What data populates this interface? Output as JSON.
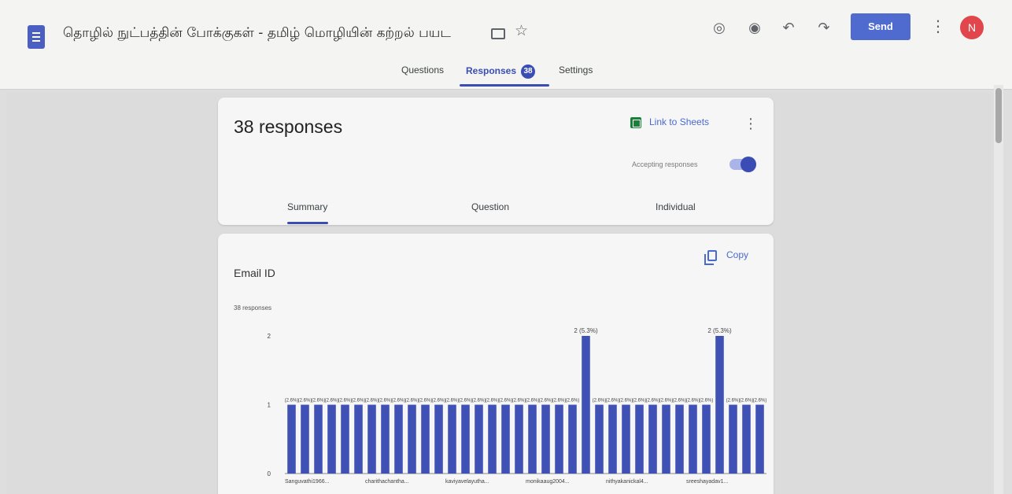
{
  "header": {
    "form_title": "தொழில் நுட்பத்தின் போக்குகள் - தமிழ் மொழியின் கற்றல் பயட",
    "send_label": "Send",
    "avatar_initial": "N",
    "tabs": [
      {
        "label": "Questions"
      },
      {
        "label": "Responses",
        "badge": "38"
      },
      {
        "label": "Settings"
      }
    ]
  },
  "summary_card": {
    "response_count": "38 responses",
    "link_to_sheets": "Link to Sheets",
    "accepting_label": "Accepting responses",
    "sub_tabs": [
      "Summary",
      "Question",
      "Individual"
    ]
  },
  "question_card": {
    "copy_label": "Copy",
    "title": "Email ID",
    "count": "38 responses"
  },
  "colors": {
    "accent": "#3a4db5",
    "send_button": "#4f6bd0",
    "bar": "#3f51b5",
    "avatar": "#e0464b"
  },
  "chart_data": {
    "type": "bar",
    "categories": [
      "Sanguvathi1966...",
      "",
      "",
      "",
      "",
      "",
      "charithachantha...",
      "",
      "",
      "",
      "",
      "",
      "kaviyavelayutha...",
      "",
      "",
      "",
      "",
      "",
      "monikaaug2004...",
      "",
      "",
      "",
      "",
      "",
      "nithyakanickal4...",
      "",
      "",
      "",
      "",
      "",
      "sreeshayadav1...",
      "",
      "",
      "",
      "",
      ""
    ],
    "values": [
      1,
      1,
      1,
      1,
      1,
      1,
      1,
      1,
      1,
      1,
      1,
      1,
      1,
      1,
      1,
      1,
      1,
      1,
      1,
      1,
      1,
      1,
      2,
      1,
      1,
      1,
      1,
      1,
      1,
      1,
      1,
      1,
      2,
      1,
      1,
      1
    ],
    "data_labels": [
      "1 (2.6%)",
      "2 (5.3%)"
    ],
    "y_ticks": [
      0,
      1,
      2
    ],
    "ylim": [
      0,
      2
    ]
  }
}
